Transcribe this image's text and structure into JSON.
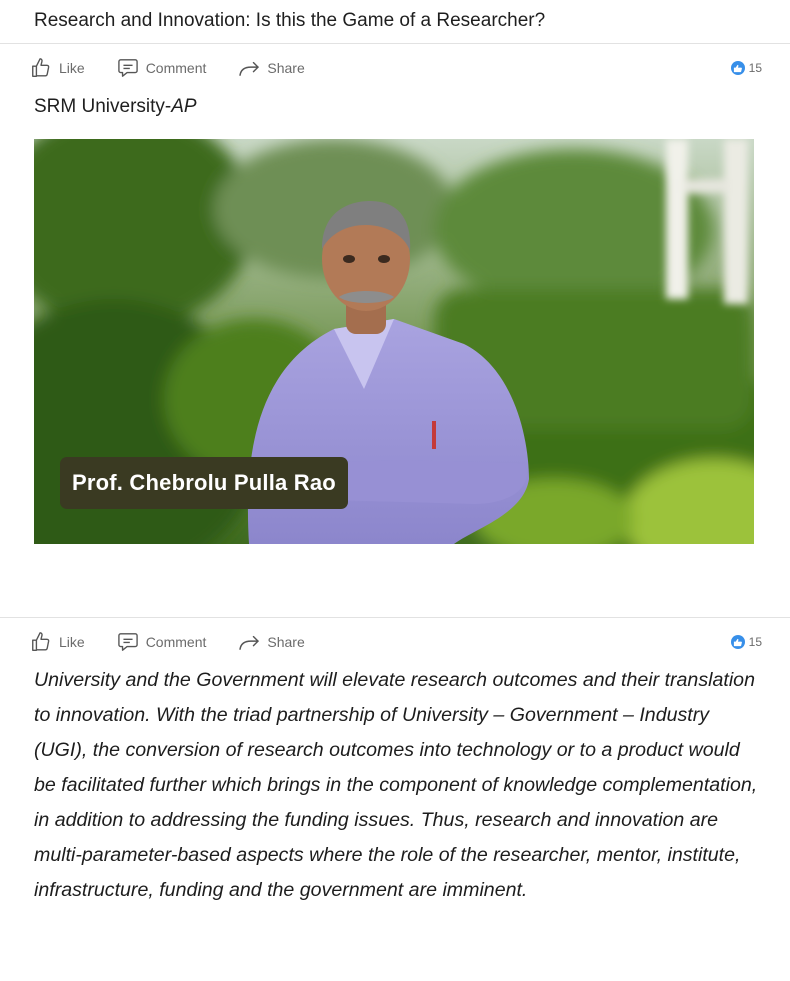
{
  "article": {
    "title": "Research and Innovation: Is this the Game of a Researcher?",
    "author_main": "SRM University-",
    "author_suffix": "AP",
    "photo_caption": "Prof. Chebrolu Pulla Rao",
    "body": "University and the Government will elevate research outcomes and their translation to innovation. With the triad partnership of University – Government – Industry (UGI), the conversion of research outcomes into technology or to a product would be facilitated further which brings in the component of knowledge complementation, in addition to addressing the funding issues. Thus, research and innovation are multi-parameter-based aspects where the role of the researcher, mentor, institute, infrastructure, funding and the government are imminent."
  },
  "action_bar": {
    "like_label": "Like",
    "comment_label": "Comment",
    "share_label": "Share",
    "reaction_count": "15",
    "like_icon": "thumbs-up-icon",
    "comment_icon": "comment-bubble-icon",
    "share_icon": "share-arrow-icon",
    "reaction_icon": "like-reaction-icon"
  },
  "colors": {
    "accent": "#378fe9",
    "muted_text": "#6b6b6b",
    "caption_bg": "#3a3a22"
  }
}
